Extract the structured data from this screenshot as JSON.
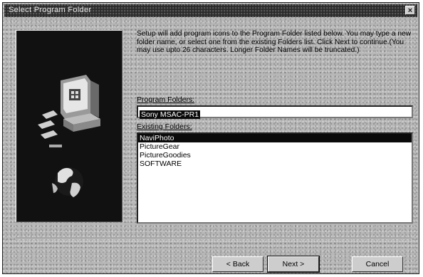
{
  "window": {
    "title": "Select Program Folder",
    "close_label": "×"
  },
  "description": "Setup will add program icons to the Program Folder listed below. You may type a new folder name, or select one from the existing Folders list. Click Next to continue.(You may use upto 26 characters. Longer Folder Names will be truncated.)",
  "program_folder": {
    "label": "Program Folders:",
    "value": "Sony MSAC-PR1"
  },
  "existing_folders": {
    "label": "Existing Folders:",
    "items": [
      "NaviPhoto",
      "PictureGear",
      "PictureGoodies",
      "SOFTWARE"
    ],
    "selected": "NaviPhoto"
  },
  "buttons": {
    "back": "< Back",
    "next": "Next >",
    "cancel": "Cancel"
  }
}
